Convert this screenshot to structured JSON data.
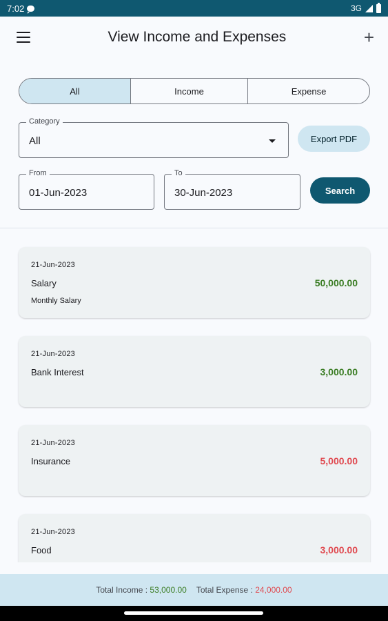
{
  "status_bar": {
    "time": "7:02",
    "network": "3G"
  },
  "header": {
    "title": "View Income and Expenses"
  },
  "filter_tabs": [
    {
      "label": "All",
      "selected": true
    },
    {
      "label": "Income",
      "selected": false
    },
    {
      "label": "Expense",
      "selected": false
    }
  ],
  "category": {
    "label": "Category",
    "value": "All"
  },
  "export_button": {
    "label": "Export PDF"
  },
  "date_from": {
    "label": "From",
    "value": "01-Jun-2023"
  },
  "date_to": {
    "label": "To",
    "value": "30-Jun-2023"
  },
  "search_button": {
    "label": "Search"
  },
  "transactions": [
    {
      "date": "21-Jun-2023",
      "category": "Salary",
      "note": "Monthly Salary",
      "amount": "50,000.00",
      "type": "income"
    },
    {
      "date": "21-Jun-2023",
      "category": "Bank Interest",
      "note": "",
      "amount": "3,000.00",
      "type": "income"
    },
    {
      "date": "21-Jun-2023",
      "category": "Insurance",
      "note": "",
      "amount": "5,000.00",
      "type": "expense"
    },
    {
      "date": "21-Jun-2023",
      "category": "Food",
      "note": "",
      "amount": "3,000.00",
      "type": "expense"
    }
  ],
  "totals": {
    "income_label": "Total Income :",
    "income_value": "53,000.00",
    "expense_label": "Total Expense :",
    "expense_value": "24,000.00"
  },
  "colors": {
    "primary": "#0f5870",
    "selected_tab": "#cfe6f1",
    "income": "#3b7d24",
    "expense": "#e04a50"
  }
}
